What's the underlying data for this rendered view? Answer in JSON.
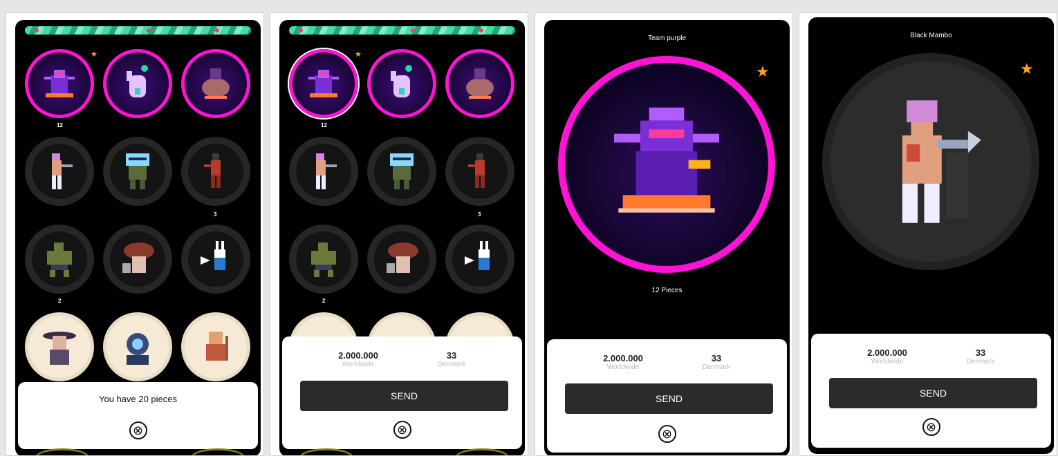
{
  "screens": {
    "s1": {
      "counts": {
        "first": "12",
        "sixth": "3",
        "seventh": "2"
      },
      "footer_text": "You have 20 pieces",
      "close_icon": "⊗"
    },
    "s2": {
      "counts": {
        "first": "12",
        "sixth": "3",
        "seventh": "2"
      },
      "worldwide_value": "2.000.000",
      "worldwide_label": "Worldwide",
      "denmark_value": "33",
      "denmark_label": "Denmark",
      "send_label": "SEND",
      "close_icon": "⊗"
    },
    "s3": {
      "title": "Team purple",
      "pieces_text": "12 Pieces",
      "worldwide_value": "2.000.000",
      "worldwide_label": "Worldwide",
      "denmark_value": "33",
      "denmark_label": "Denmark",
      "send_label": "SEND",
      "close_icon": "⊗"
    },
    "s4": {
      "title": "Black Mambo",
      "worldwide_value": "2.000.000",
      "worldwide_label": "Worldwide",
      "denmark_value": "33",
      "denmark_label": "Denmark",
      "send_label": "SEND",
      "close_icon": "⊗"
    }
  },
  "icons": {
    "star": "★",
    "close": "close-circle-icon"
  },
  "colors": {
    "accent_magenta": "#ff13d4",
    "star_orange": "#ffa21a",
    "button_dark": "#2b2b2b"
  }
}
